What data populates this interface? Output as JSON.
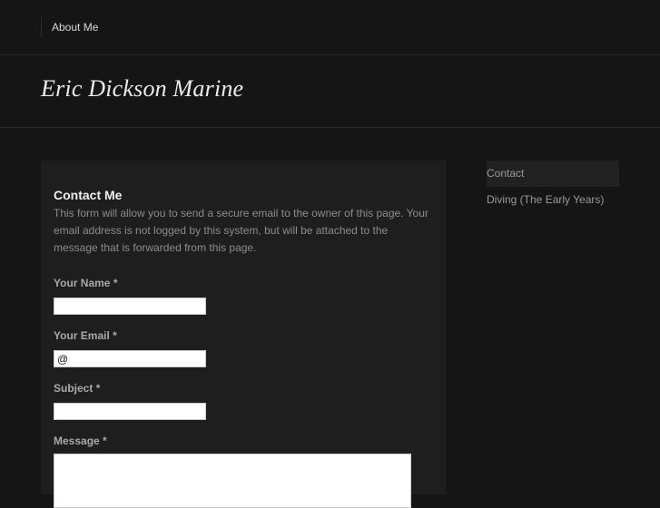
{
  "nav": {
    "items": [
      {
        "label": "About Me"
      }
    ]
  },
  "site": {
    "title": "Eric Dickson Marine"
  },
  "contact": {
    "heading": "Contact Me",
    "description": "This form will allow you to send a secure email to the owner of this page. Your email address is not logged by this system, but will be attached to the message that is forwarded from this page.",
    "required_marker": "*",
    "fields": {
      "name": {
        "label": "Your Name",
        "value": ""
      },
      "email": {
        "label": "Your Email",
        "value": "@"
      },
      "subject": {
        "label": "Subject",
        "value": ""
      },
      "message": {
        "label": "Message",
        "value": ""
      }
    }
  },
  "sidebar": {
    "items": [
      {
        "label": "Contact",
        "active": true
      },
      {
        "label": "Diving (The Early Years)",
        "active": false
      }
    ]
  }
}
